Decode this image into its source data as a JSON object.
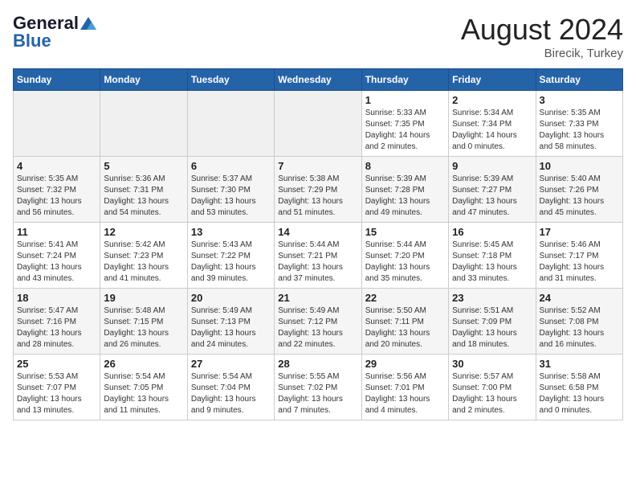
{
  "logo": {
    "general": "General",
    "blue": "Blue"
  },
  "title": {
    "month_year": "August 2024",
    "location": "Birecik, Turkey"
  },
  "weekdays": [
    "Sunday",
    "Monday",
    "Tuesday",
    "Wednesday",
    "Thursday",
    "Friday",
    "Saturday"
  ],
  "weeks": [
    [
      {
        "day": "",
        "sunrise": "",
        "sunset": "",
        "daylight": ""
      },
      {
        "day": "",
        "sunrise": "",
        "sunset": "",
        "daylight": ""
      },
      {
        "day": "",
        "sunrise": "",
        "sunset": "",
        "daylight": ""
      },
      {
        "day": "",
        "sunrise": "",
        "sunset": "",
        "daylight": ""
      },
      {
        "day": "1",
        "sunrise": "Sunrise: 5:33 AM",
        "sunset": "Sunset: 7:35 PM",
        "daylight": "Daylight: 14 hours and 2 minutes."
      },
      {
        "day": "2",
        "sunrise": "Sunrise: 5:34 AM",
        "sunset": "Sunset: 7:34 PM",
        "daylight": "Daylight: 14 hours and 0 minutes."
      },
      {
        "day": "3",
        "sunrise": "Sunrise: 5:35 AM",
        "sunset": "Sunset: 7:33 PM",
        "daylight": "Daylight: 13 hours and 58 minutes."
      }
    ],
    [
      {
        "day": "4",
        "sunrise": "Sunrise: 5:35 AM",
        "sunset": "Sunset: 7:32 PM",
        "daylight": "Daylight: 13 hours and 56 minutes."
      },
      {
        "day": "5",
        "sunrise": "Sunrise: 5:36 AM",
        "sunset": "Sunset: 7:31 PM",
        "daylight": "Daylight: 13 hours and 54 minutes."
      },
      {
        "day": "6",
        "sunrise": "Sunrise: 5:37 AM",
        "sunset": "Sunset: 7:30 PM",
        "daylight": "Daylight: 13 hours and 53 minutes."
      },
      {
        "day": "7",
        "sunrise": "Sunrise: 5:38 AM",
        "sunset": "Sunset: 7:29 PM",
        "daylight": "Daylight: 13 hours and 51 minutes."
      },
      {
        "day": "8",
        "sunrise": "Sunrise: 5:39 AM",
        "sunset": "Sunset: 7:28 PM",
        "daylight": "Daylight: 13 hours and 49 minutes."
      },
      {
        "day": "9",
        "sunrise": "Sunrise: 5:39 AM",
        "sunset": "Sunset: 7:27 PM",
        "daylight": "Daylight: 13 hours and 47 minutes."
      },
      {
        "day": "10",
        "sunrise": "Sunrise: 5:40 AM",
        "sunset": "Sunset: 7:26 PM",
        "daylight": "Daylight: 13 hours and 45 minutes."
      }
    ],
    [
      {
        "day": "11",
        "sunrise": "Sunrise: 5:41 AM",
        "sunset": "Sunset: 7:24 PM",
        "daylight": "Daylight: 13 hours and 43 minutes."
      },
      {
        "day": "12",
        "sunrise": "Sunrise: 5:42 AM",
        "sunset": "Sunset: 7:23 PM",
        "daylight": "Daylight: 13 hours and 41 minutes."
      },
      {
        "day": "13",
        "sunrise": "Sunrise: 5:43 AM",
        "sunset": "Sunset: 7:22 PM",
        "daylight": "Daylight: 13 hours and 39 minutes."
      },
      {
        "day": "14",
        "sunrise": "Sunrise: 5:44 AM",
        "sunset": "Sunset: 7:21 PM",
        "daylight": "Daylight: 13 hours and 37 minutes."
      },
      {
        "day": "15",
        "sunrise": "Sunrise: 5:44 AM",
        "sunset": "Sunset: 7:20 PM",
        "daylight": "Daylight: 13 hours and 35 minutes."
      },
      {
        "day": "16",
        "sunrise": "Sunrise: 5:45 AM",
        "sunset": "Sunset: 7:18 PM",
        "daylight": "Daylight: 13 hours and 33 minutes."
      },
      {
        "day": "17",
        "sunrise": "Sunrise: 5:46 AM",
        "sunset": "Sunset: 7:17 PM",
        "daylight": "Daylight: 13 hours and 31 minutes."
      }
    ],
    [
      {
        "day": "18",
        "sunrise": "Sunrise: 5:47 AM",
        "sunset": "Sunset: 7:16 PM",
        "daylight": "Daylight: 13 hours and 28 minutes."
      },
      {
        "day": "19",
        "sunrise": "Sunrise: 5:48 AM",
        "sunset": "Sunset: 7:15 PM",
        "daylight": "Daylight: 13 hours and 26 minutes."
      },
      {
        "day": "20",
        "sunrise": "Sunrise: 5:49 AM",
        "sunset": "Sunset: 7:13 PM",
        "daylight": "Daylight: 13 hours and 24 minutes."
      },
      {
        "day": "21",
        "sunrise": "Sunrise: 5:49 AM",
        "sunset": "Sunset: 7:12 PM",
        "daylight": "Daylight: 13 hours and 22 minutes."
      },
      {
        "day": "22",
        "sunrise": "Sunrise: 5:50 AM",
        "sunset": "Sunset: 7:11 PM",
        "daylight": "Daylight: 13 hours and 20 minutes."
      },
      {
        "day": "23",
        "sunrise": "Sunrise: 5:51 AM",
        "sunset": "Sunset: 7:09 PM",
        "daylight": "Daylight: 13 hours and 18 minutes."
      },
      {
        "day": "24",
        "sunrise": "Sunrise: 5:52 AM",
        "sunset": "Sunset: 7:08 PM",
        "daylight": "Daylight: 13 hours and 16 minutes."
      }
    ],
    [
      {
        "day": "25",
        "sunrise": "Sunrise: 5:53 AM",
        "sunset": "Sunset: 7:07 PM",
        "daylight": "Daylight: 13 hours and 13 minutes."
      },
      {
        "day": "26",
        "sunrise": "Sunrise: 5:54 AM",
        "sunset": "Sunset: 7:05 PM",
        "daylight": "Daylight: 13 hours and 11 minutes."
      },
      {
        "day": "27",
        "sunrise": "Sunrise: 5:54 AM",
        "sunset": "Sunset: 7:04 PM",
        "daylight": "Daylight: 13 hours and 9 minutes."
      },
      {
        "day": "28",
        "sunrise": "Sunrise: 5:55 AM",
        "sunset": "Sunset: 7:02 PM",
        "daylight": "Daylight: 13 hours and 7 minutes."
      },
      {
        "day": "29",
        "sunrise": "Sunrise: 5:56 AM",
        "sunset": "Sunset: 7:01 PM",
        "daylight": "Daylight: 13 hours and 4 minutes."
      },
      {
        "day": "30",
        "sunrise": "Sunrise: 5:57 AM",
        "sunset": "Sunset: 7:00 PM",
        "daylight": "Daylight: 13 hours and 2 minutes."
      },
      {
        "day": "31",
        "sunrise": "Sunrise: 5:58 AM",
        "sunset": "Sunset: 6:58 PM",
        "daylight": "Daylight: 13 hours and 0 minutes."
      }
    ]
  ]
}
